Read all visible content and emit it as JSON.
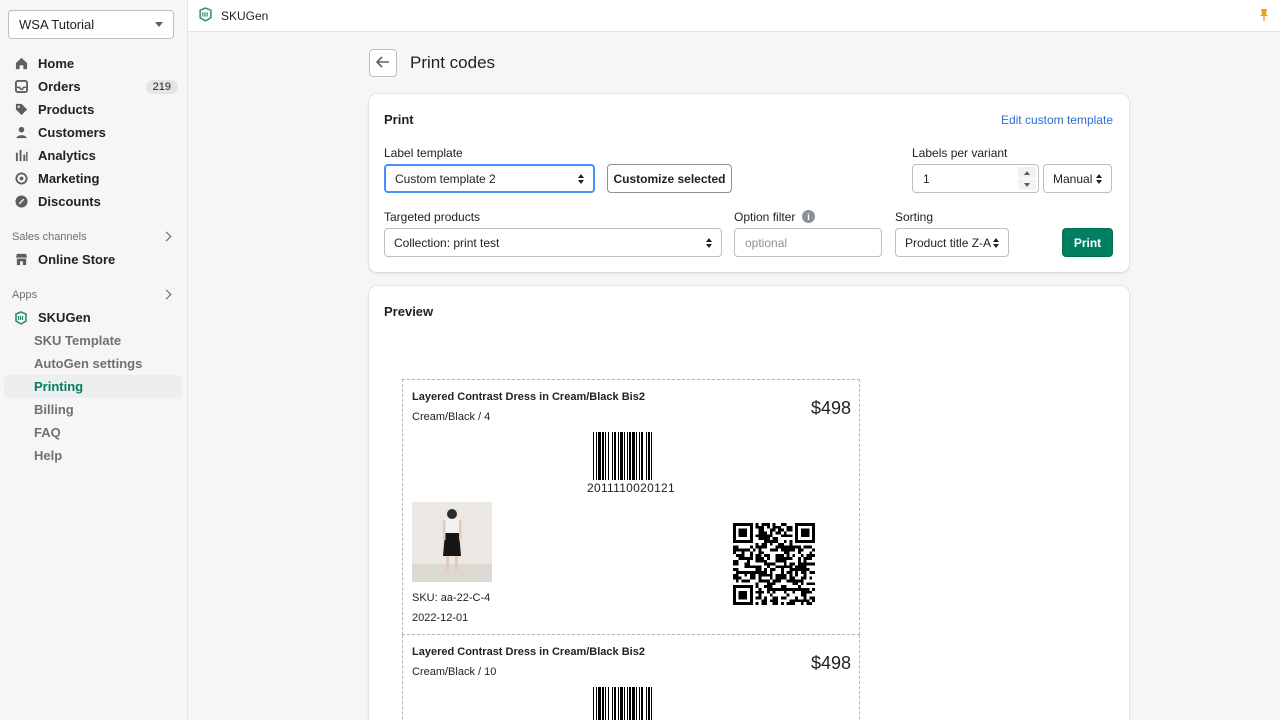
{
  "sidebar": {
    "store_name": "WSA Tutorial",
    "items": [
      {
        "label": "Home",
        "icon": "home-icon"
      },
      {
        "label": "Orders",
        "icon": "orders-icon",
        "badge": "219"
      },
      {
        "label": "Products",
        "icon": "tag-icon"
      },
      {
        "label": "Customers",
        "icon": "person-icon"
      },
      {
        "label": "Analytics",
        "icon": "bar-chart-icon"
      },
      {
        "label": "Marketing",
        "icon": "target-icon"
      },
      {
        "label": "Discounts",
        "icon": "discount-icon"
      }
    ],
    "sales_channels": {
      "label": "Sales channels",
      "items": [
        {
          "label": "Online Store",
          "icon": "store-icon"
        }
      ]
    },
    "apps": {
      "label": "Apps",
      "app": {
        "label": "SKUGen",
        "icon": "skugen-icon"
      },
      "sub_items": [
        "SKU Template",
        "AutoGen settings",
        "Printing",
        "Billing",
        "FAQ",
        "Help"
      ],
      "active": "Printing"
    }
  },
  "topbar": {
    "app_name": "SKUGen"
  },
  "page": {
    "title": "Print codes"
  },
  "print_card": {
    "title": "Print",
    "edit_link": "Edit custom template",
    "label_template": {
      "label": "Label template",
      "value": "Custom template 2"
    },
    "customize_button": "Customize selected",
    "labels_per_variant": {
      "label": "Labels per variant",
      "value": "1",
      "mode": "Manual"
    },
    "targeted_products": {
      "label": "Targeted products",
      "value": "Collection: print test"
    },
    "option_filter": {
      "label": "Option filter",
      "placeholder": "optional"
    },
    "sorting": {
      "label": "Sorting",
      "value": "Product title Z-A"
    },
    "print_button": "Print"
  },
  "preview": {
    "title": "Preview",
    "labels": [
      {
        "title": "Layered Contrast Dress in Cream/Black Bis2",
        "variant": "Cream/Black / 4",
        "price": "$498",
        "barcode": "2011110020121",
        "sku": "SKU: aa-22-C-4",
        "date": "2022-12-01"
      },
      {
        "title": "Layered Contrast Dress in Cream/Black Bis2",
        "variant": "Cream/Black / 10",
        "price": "$498"
      }
    ]
  },
  "colors": {
    "accent": "#008060",
    "link": "#2c6ecb",
    "focus": "#458fff"
  }
}
